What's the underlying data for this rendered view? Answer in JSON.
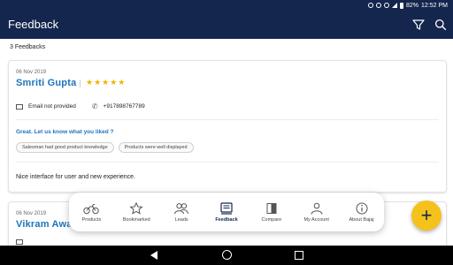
{
  "status_bar": {
    "battery": "82%",
    "time": "12:52 PM"
  },
  "app_bar": {
    "title": "Feedback",
    "filter_icon": "filter-icon",
    "search_icon": "search-icon"
  },
  "feedback_count": "3 Feedbacks",
  "cards": [
    {
      "date": "06 Nov 2019",
      "name": "Smriti Gupta",
      "rating": 5,
      "stars": "★★★★★",
      "email": "Email not provided",
      "phone": "+917898767789",
      "liked_heading": "Great. Let us know what you liked ?",
      "tags": [
        "Salesman had good product knowledge",
        "Products were well displayed"
      ],
      "comment": "Nice interface for user and new experience."
    },
    {
      "date": "06 Nov 2019",
      "name": "Vikram Awal"
    }
  ],
  "bottom_nav": {
    "items": [
      {
        "label": "Products",
        "icon": "motorcycle-icon"
      },
      {
        "label": "Bookmarked",
        "icon": "star-icon"
      },
      {
        "label": "Leads",
        "icon": "people-icon"
      },
      {
        "label": "Feedback",
        "icon": "feedback-icon",
        "active": true
      },
      {
        "label": "Compare",
        "icon": "compare-icon"
      },
      {
        "label": "My Account",
        "icon": "account-icon"
      },
      {
        "label": "About Bajaj",
        "icon": "info-icon"
      }
    ]
  },
  "fab": {
    "label": "+"
  },
  "colors": {
    "primary": "#14264d",
    "accent": "#1d74ba",
    "star": "#f0b400",
    "fab": "#f5c21b"
  }
}
